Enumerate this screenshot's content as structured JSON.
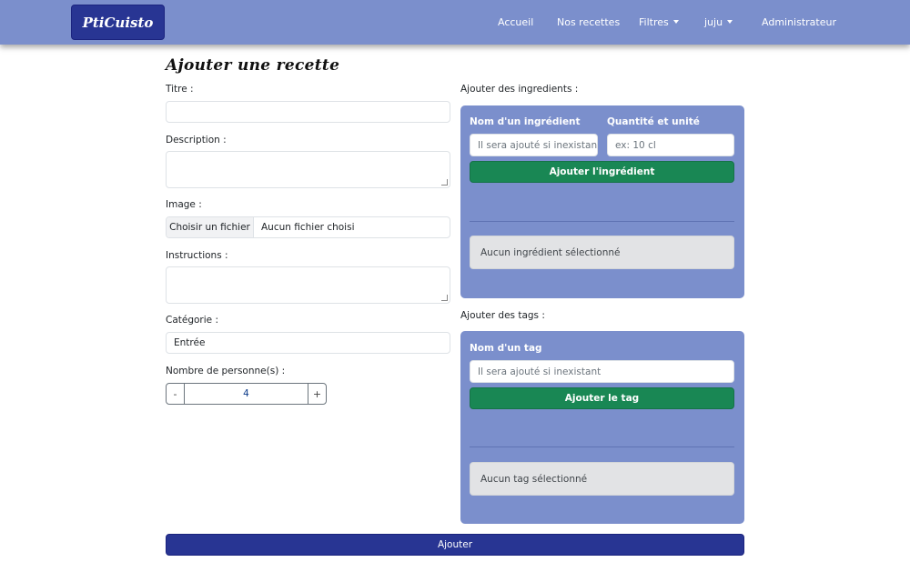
{
  "navbar": {
    "brand": "PtiCuisto",
    "links": {
      "home": "Accueil",
      "recipes": "Nos recettes",
      "filters": "Filtres",
      "user": "juju",
      "admin": "Administrateur"
    }
  },
  "page": {
    "title": "Ajouter une recette"
  },
  "form": {
    "title_label": "Titre :",
    "title_value": "",
    "description_label": "Description :",
    "description_value": "",
    "image_label": "Image :",
    "image_button": "Choisir un fichier",
    "image_status": "Aucun fichier choisi",
    "instructions_label": "Instructions :",
    "instructions_value": "",
    "category_label": "Catégorie :",
    "category_value": "Entrée",
    "persons_label": "Nombre de personne(s) :",
    "persons_minus": "-",
    "persons_value": "4",
    "persons_plus": "+",
    "submit_label": "Ajouter"
  },
  "ingredients": {
    "section_label": "Ajouter des ingredients :",
    "name_label": "Nom d'un ingrédient",
    "name_placeholder": "Il sera ajouté si inexistant",
    "quantity_label": "Quantité et unité",
    "quantity_placeholder": "ex: 10 cl",
    "add_button": "Ajouter l'ingrédient",
    "empty_message": "Aucun ingrédient sélectionné"
  },
  "tags": {
    "section_label": "Ajouter des tags :",
    "name_label": "Nom d'un tag",
    "name_placeholder": "Il sera ajouté si inexistant",
    "add_button": "Ajouter le tag",
    "empty_message": "Aucun tag sélectionné"
  },
  "colors": {
    "navbar": "#7b8fcc",
    "brand": "#283593",
    "panel": "#7b8fcc",
    "add_button": "#198754",
    "submit": "#283593"
  }
}
